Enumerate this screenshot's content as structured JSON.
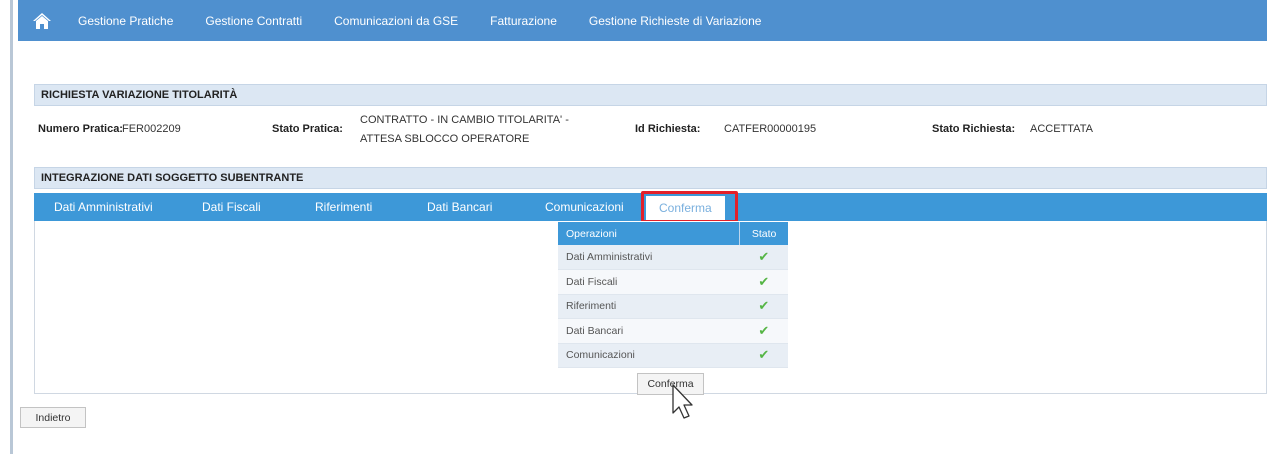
{
  "nav": {
    "home_icon": "home-icon",
    "items": [
      "Gestione Pratiche",
      "Gestione Contratti",
      "Comunicazioni da GSE",
      "Fatturazione",
      "Gestione Richieste di Variazione"
    ]
  },
  "section1": {
    "title": "RICHIESTA VARIAZIONE TITOLARITÀ"
  },
  "info": {
    "numero_pratica_label": "Numero Pratica:",
    "numero_pratica_value": "FER002209",
    "stato_pratica_label": "Stato Pratica:",
    "stato_pratica_value": "CONTRATTO - IN CAMBIO TITOLARITA' - ATTESA SBLOCCO OPERATORE",
    "id_richiesta_label": "Id Richiesta:",
    "id_richiesta_value": "CATFER00000195",
    "stato_richiesta_label": "Stato Richiesta:",
    "stato_richiesta_value": "ACCETTATA"
  },
  "section2": {
    "title": "INTEGRAZIONE DATI SOGGETTO SUBENTRANTE"
  },
  "tabs": [
    "Dati Amministrativi",
    "Dati Fiscali",
    "Riferimenti",
    "Dati Bancari",
    "Comunicazioni",
    "Conferma"
  ],
  "active_tab": "Conferma",
  "ops_table": {
    "headers": [
      "Operazioni",
      "Stato"
    ],
    "rows": [
      {
        "op": "Dati Amministrativi",
        "stato": "✔"
      },
      {
        "op": "Dati Fiscali",
        "stato": "✔"
      },
      {
        "op": "Riferimenti",
        "stato": "✔"
      },
      {
        "op": "Dati Bancari",
        "stato": "✔"
      },
      {
        "op": "Comunicazioni",
        "stato": "✔"
      }
    ]
  },
  "confirm_button": "Conferma",
  "back_button": "Indietro",
  "colors": {
    "nav": "#4f90cf",
    "tabbar": "#3d98d8",
    "highlight": "#e2202a",
    "check": "#55b545"
  }
}
